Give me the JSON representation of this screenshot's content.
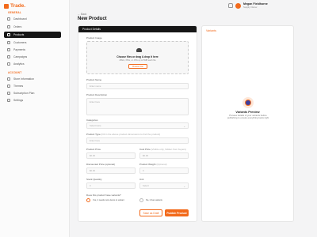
{
  "app": {
    "name": "Trade."
  },
  "sidebar": {
    "general_label": "GENERAL",
    "general_items": [
      {
        "label": "Dashboard",
        "icon": "grid-icon"
      },
      {
        "label": "Orders",
        "icon": "cart-icon"
      },
      {
        "label": "Products",
        "icon": "box-icon",
        "active": true
      },
      {
        "label": "Customers",
        "icon": "users-icon"
      },
      {
        "label": "Payments",
        "icon": "card-icon"
      },
      {
        "label": "Campaigns",
        "icon": "megaphone-icon"
      },
      {
        "label": "Analytics",
        "icon": "chart-icon"
      }
    ],
    "account_label": "ACCOUNT",
    "account_items": [
      {
        "label": "Store Information",
        "icon": "store-icon"
      },
      {
        "label": "Themes",
        "icon": "palette-icon"
      },
      {
        "label": "Subscription Plan",
        "icon": "crown-icon"
      },
      {
        "label": "Settings",
        "icon": "gear-icon"
      }
    ]
  },
  "header": {
    "user_name": "Megan Fieldhorne",
    "user_role": "Supply Owner",
    "breadcrumb": "← Back",
    "page_title": "New Product"
  },
  "form": {
    "section_title": "Product Details",
    "image_label": "Product Image",
    "upload_main": "Choose files or drag & drop it here",
    "upload_sub": "JPEG, PNG, or JPG up to 5MB each file",
    "upload_button": "Browse File",
    "name_label": "Product Name",
    "name_placeholder": "Enter name",
    "desc_label": "Product Description",
    "desc_placeholder": "Enter here",
    "category_label": "Categories",
    "category_placeholder": "Select Here",
    "type_label": "Product Type",
    "type_hint": "(Fill in the above product dimensions to find the product)",
    "type_placeholder": "Enter here",
    "price_label": "Product Price",
    "price_placeholder": "$0.00",
    "cost_label": "Cost Price",
    "cost_hint": "(Visible only, hidden from buyers)",
    "cost_placeholder": "$0.00",
    "discount_label": "Discounted Price (optional)",
    "discount_placeholder": "$0.00",
    "weight_label": "Product Weight",
    "weight_hint": "(Optional)",
    "weight_placeholder": "0",
    "stock_label": "Stock Quantity",
    "stock_placeholder": "0",
    "unit_label": "Unit",
    "unit_placeholder": "Select",
    "variants_question": "Does this product have variants?",
    "variant_yes": "Yes, it needs more items to variant",
    "variant_no": "No, it has variants",
    "save_draft": "Save as Draft",
    "publish": "Publish Product"
  },
  "variants_panel": {
    "title": "Variants",
    "preview_title": "Variants Preview",
    "preview_desc": "Preview details of your variants before publishing to ensure everything looks right"
  },
  "colors": {
    "accent": "#f26a1b",
    "dark": "#161616"
  }
}
